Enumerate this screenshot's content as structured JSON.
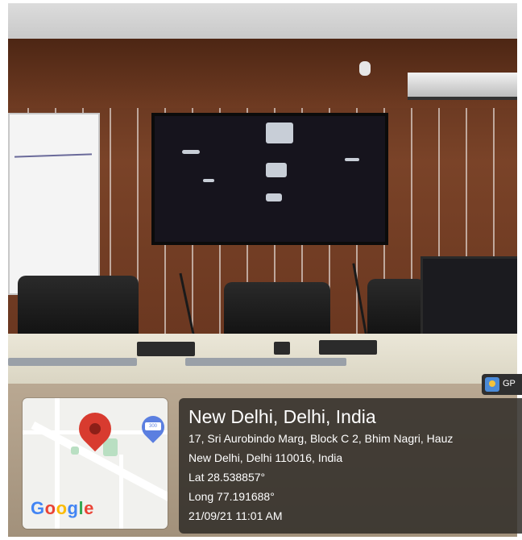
{
  "gps_badge": {
    "text": "GP"
  },
  "map": {
    "logo_text": "Google",
    "blue_pin_label": "300",
    "logo_colors": [
      "#4285F4",
      "#EA4335",
      "#FBBC05",
      "#4285F4",
      "#34A853",
      "#EA4335"
    ]
  },
  "location": {
    "title": "New Delhi, Delhi, India",
    "address_line_1": "17, Sri Aurobindo Marg, Block C 2, Bhim Nagri, Hauz",
    "address_line_2": "New Delhi, Delhi 110016, India",
    "lat": "Lat 28.538857°",
    "long": "Long 77.191688°",
    "datetime": "21/09/21 11:01 AM"
  }
}
